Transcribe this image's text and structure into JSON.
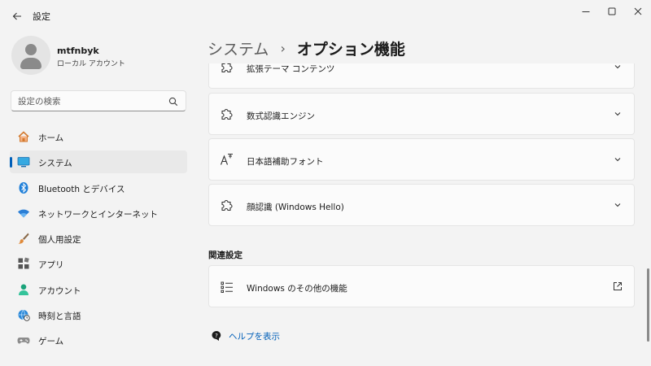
{
  "app": {
    "title": "設定"
  },
  "user": {
    "name": "mtfnbyk",
    "account_type": "ローカル アカウント"
  },
  "search": {
    "placeholder": "設定の検索",
    "value": ""
  },
  "sidebar": {
    "items": [
      {
        "label": "ホーム",
        "icon": "home-icon",
        "selected": false
      },
      {
        "label": "システム",
        "icon": "system-display-icon",
        "selected": true
      },
      {
        "label": "Bluetooth とデバイス",
        "icon": "bluetooth-icon",
        "selected": false
      },
      {
        "label": "ネットワークとインターネット",
        "icon": "wifi-icon",
        "selected": false
      },
      {
        "label": "個人用設定",
        "icon": "paintbrush-icon",
        "selected": false
      },
      {
        "label": "アプリ",
        "icon": "apps-icon",
        "selected": false
      },
      {
        "label": "アカウント",
        "icon": "account-icon",
        "selected": false
      },
      {
        "label": "時刻と言語",
        "icon": "time-language-icon",
        "selected": false
      },
      {
        "label": "ゲーム",
        "icon": "gamepad-icon",
        "selected": false
      }
    ]
  },
  "breadcrumb": {
    "parent": "システム",
    "separator": "›",
    "current": "オプション機能"
  },
  "features": [
    {
      "label": "拡張テーマ コンテンツ",
      "icon": "puzzle-icon"
    },
    {
      "label": "数式認識エンジン",
      "icon": "puzzle-icon"
    },
    {
      "label": "日本語補助フォント",
      "icon": "font-icon"
    },
    {
      "label": "顔認識 (Windows Hello)",
      "icon": "puzzle-icon"
    }
  ],
  "related": {
    "heading": "関連設定",
    "items": [
      {
        "label": "Windows のその他の機能",
        "icon": "list-icon",
        "action_icon": "open-external-icon"
      }
    ]
  },
  "help": {
    "label": "ヘルプを表示",
    "icon": "help-icon"
  },
  "colors": {
    "accent": "#005fb8",
    "background": "#f3f3f3",
    "card": "#fbfbfb"
  }
}
